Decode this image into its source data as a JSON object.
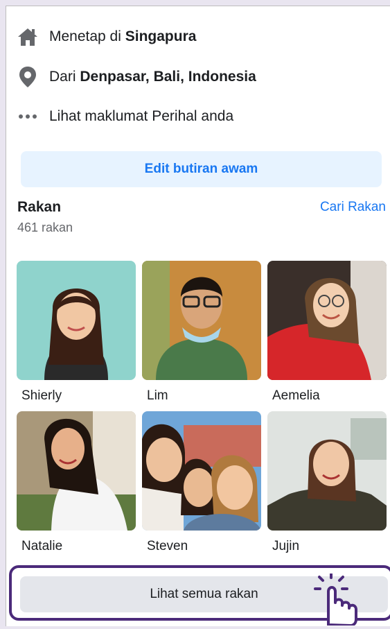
{
  "about": {
    "lives_prefix": "Menetap di ",
    "lives_value": "Singapura",
    "from_prefix": "Dari ",
    "from_value": "Denpasar, Bali, Indonesia",
    "see_about": "Lihat maklumat Perihal anda"
  },
  "edit_button_label": "Edit butiran awam",
  "friends": {
    "title": "Rakan",
    "count": "461 rakan",
    "find_link": "Cari Rakan",
    "items": [
      {
        "name": "Shierly"
      },
      {
        "name": "Lim"
      },
      {
        "name": "Aemelia"
      },
      {
        "name": "Natalie"
      },
      {
        "name": "Steven"
      },
      {
        "name": "Jujin"
      }
    ],
    "see_all_label": "Lihat semua rakan"
  },
  "icons": [
    "home-icon",
    "location-pin-icon",
    "more-dots-icon",
    "pointing-hand-icon"
  ],
  "colors": {
    "accent": "#1877f2",
    "highlight": "#4b2a7a",
    "edit_bg": "#e7f3ff",
    "button_bg": "#e4e6eb"
  }
}
